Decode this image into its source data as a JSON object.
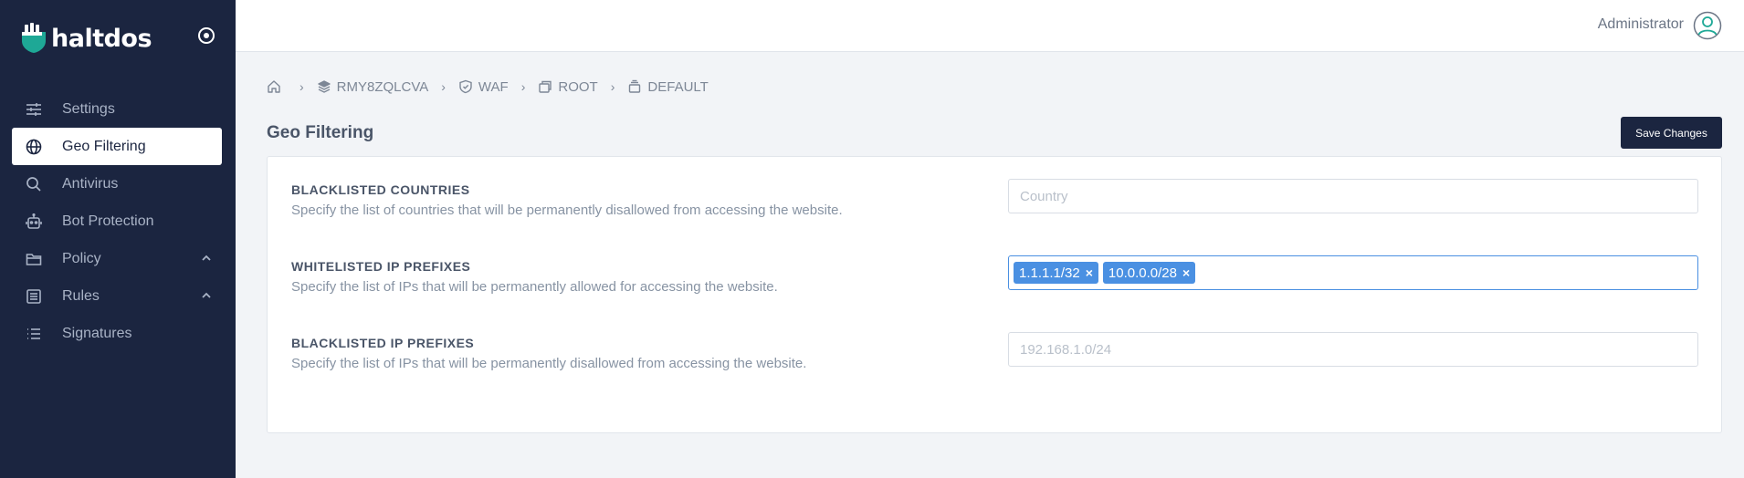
{
  "brand": {
    "name": "haltdos",
    "accent_color": "#1ea896"
  },
  "sidebar": {
    "items": [
      {
        "label": "Settings",
        "icon": "sliders-icon",
        "active": false
      },
      {
        "label": "Geo Filtering",
        "icon": "globe-icon",
        "active": true
      },
      {
        "label": "Antivirus",
        "icon": "search-icon",
        "active": false
      },
      {
        "label": "Bot Protection",
        "icon": "robot-icon",
        "active": false
      },
      {
        "label": "Policy",
        "icon": "folder-icon",
        "active": false,
        "expandable": true
      },
      {
        "label": "Rules",
        "icon": "list-box-icon",
        "active": false,
        "expandable": true
      },
      {
        "label": "Signatures",
        "icon": "list-icon",
        "active": false
      }
    ]
  },
  "topbar": {
    "user": "Administrator"
  },
  "breadcrumb": [
    {
      "label": "",
      "icon": "home-icon"
    },
    {
      "label": "RMY8ZQLCVA",
      "icon": "layers-icon"
    },
    {
      "label": "WAF",
      "icon": "shield-check-icon"
    },
    {
      "label": "ROOT",
      "icon": "windows-icon"
    },
    {
      "label": "DEFAULT",
      "icon": "stack-icon"
    }
  ],
  "page": {
    "title": "Geo Filtering",
    "save_label": "Save Changes"
  },
  "form": {
    "blacklisted_countries": {
      "label": "BLACKLISTED COUNTRIES",
      "description": "Specify the list of countries that will be permanently disallowed from accessing the website.",
      "placeholder": "Country"
    },
    "whitelisted_ip": {
      "label": "WHITELISTED IP PREFIXES",
      "description": "Specify the list of IPs that will be permanently allowed for accessing the website.",
      "tags": [
        "1.1.1.1/32",
        "10.0.0.0/28"
      ]
    },
    "blacklisted_ip": {
      "label": "BLACKLISTED IP PREFIXES",
      "description": "Specify the list of IPs that will be permanently disallowed from accessing the website.",
      "placeholder": "192.168.1.0/24"
    }
  },
  "colors": {
    "sidebar_bg": "#1b2540",
    "tag_bg": "#4a90e2",
    "button_bg": "#1b2540"
  }
}
